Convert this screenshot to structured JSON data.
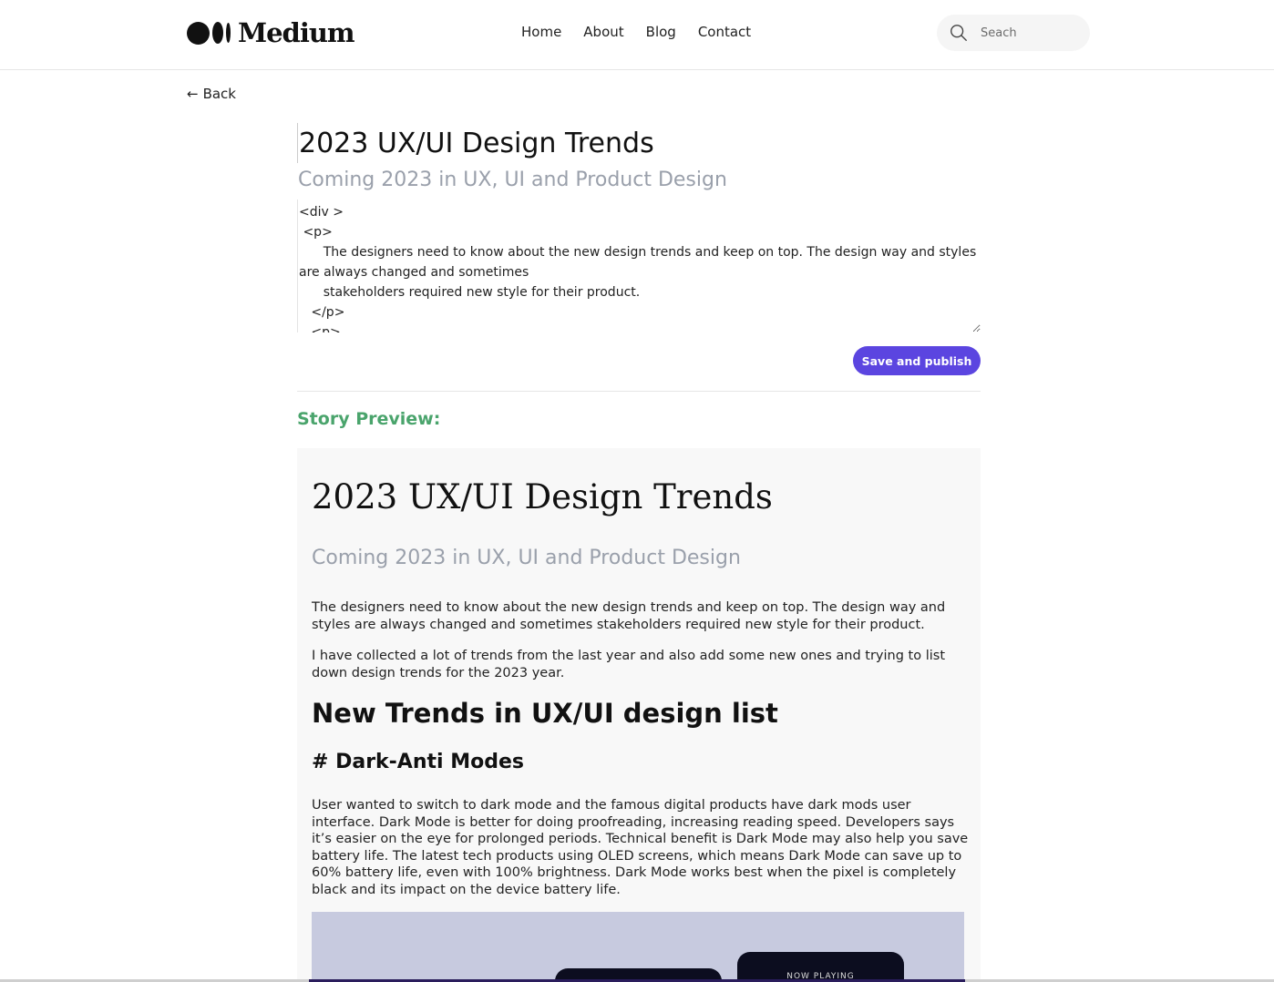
{
  "header": {
    "logo_text": "Medium",
    "nav": [
      "Home",
      "About",
      "Blog",
      "Contact"
    ],
    "search_placeholder": "Seach"
  },
  "back_label": "Back",
  "editor": {
    "title_value": "2023 UX/UI Design Trends",
    "subtitle_value": "Coming 2023 in UX, UI and Product Design",
    "body_value": "<div >\n <p>\n      The designers need to know about the new design trends and keep on top. The design way and styles are always changed and sometimes\n      stakeholders required new style for their product.\n   </p>\n   <p>",
    "publish_label": "Save and publish"
  },
  "preview": {
    "label": "Story Preview:",
    "title": "2023 UX/UI Design Trends",
    "subtitle": "Coming 2023 in UX, UI and Product Design",
    "para1": "The designers need to know about the new design trends and keep on top. The design way and styles are always changed and sometimes stakeholders required new style for their product.",
    "para2": "I have collected a lot of trends from the last year and also add some new ones and trying to list down design trends for the 2023 year.",
    "heading": "New Trends in UX/UI design list",
    "subheading": "# Dark-Anti Modes",
    "para3": "User wanted to switch to dark mode and the famous digital products have dark mods user interface. Dark Mode is better for doing proofreading, increasing reading speed. Developers says it’s easier on the eye for prolonged periods. Technical benefit is Dark Mode may also help you save battery life. The latest tech products using OLED screens, which means Dark Mode can save up to 60% battery life, even with 100% brightness. Dark Mode works best when the pixel is completely black and its impact on the device battery life.",
    "image_caption_text": "NOW PLAYING"
  },
  "colors": {
    "accent": "#5b45e0",
    "preview_label": "#4aa46c",
    "subtitle": "#9aa0ab"
  }
}
